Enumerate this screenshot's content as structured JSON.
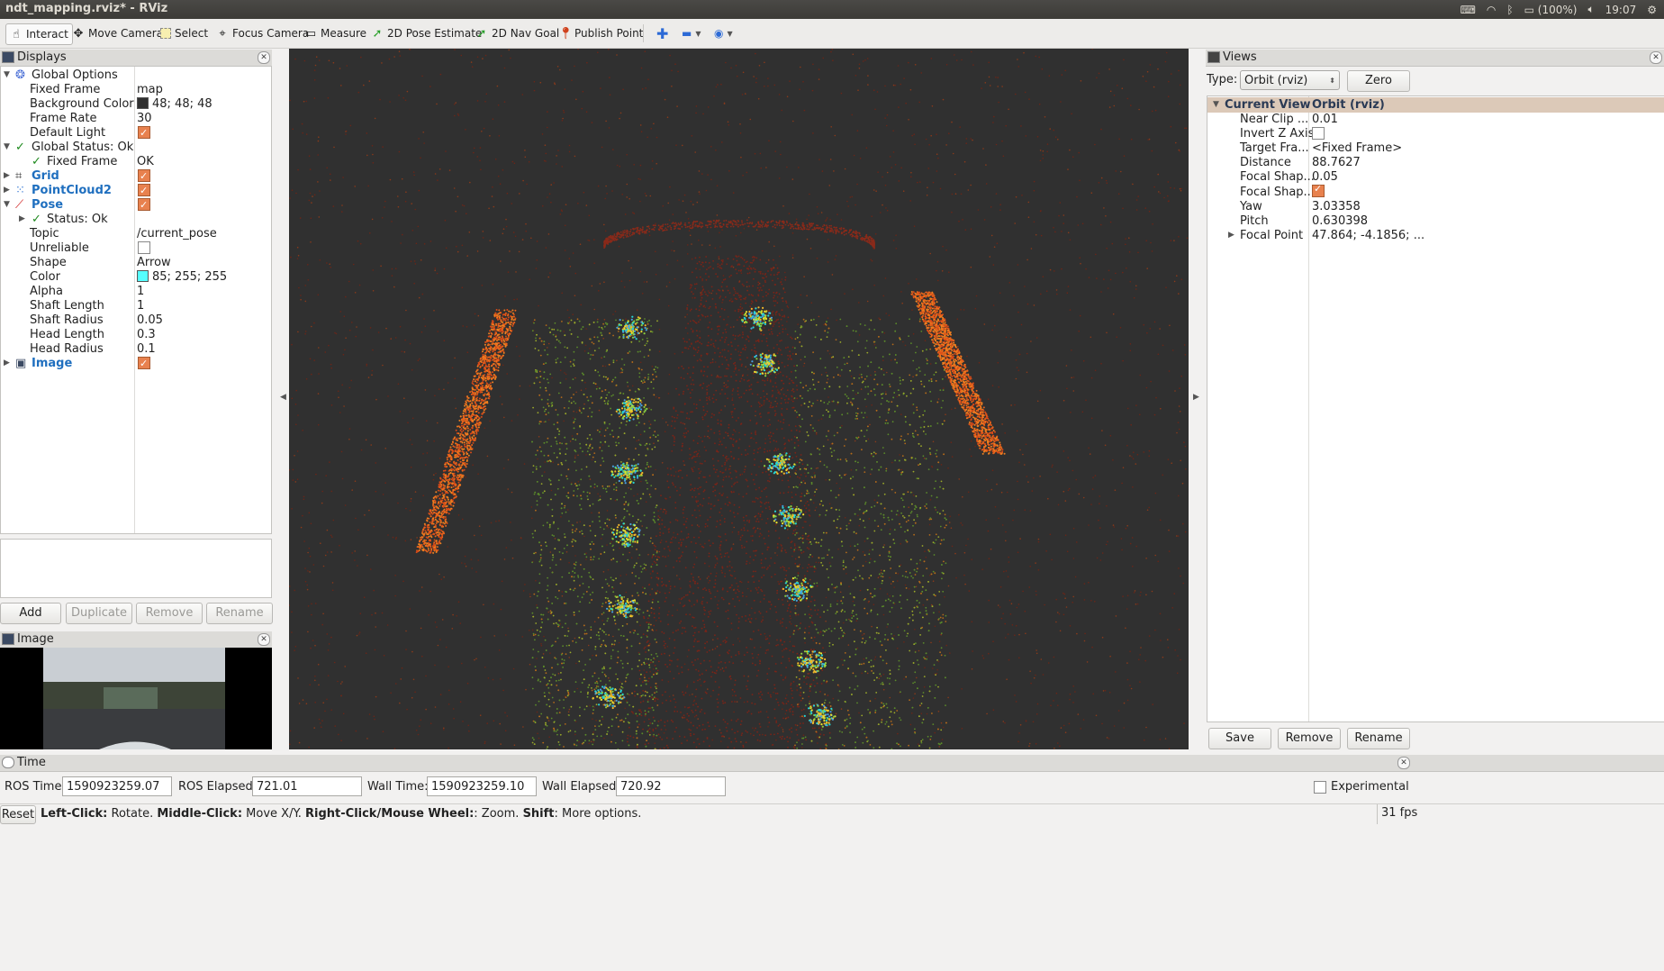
{
  "window": {
    "title": "ndt_mapping.rviz* - RViz"
  },
  "tray": {
    "battery": "(100%)",
    "clock": "19:07"
  },
  "toolbar": [
    {
      "label": "Interact",
      "icon": "hand-icon"
    },
    {
      "label": "Move Camera",
      "icon": "move-icon"
    },
    {
      "label": "Select",
      "icon": "select-icon"
    },
    {
      "label": "Focus Camera",
      "icon": "focus-icon"
    },
    {
      "label": "Measure",
      "icon": "ruler-icon"
    },
    {
      "label": "2D Pose Estimate",
      "icon": "green-arrow-icon"
    },
    {
      "label": "2D Nav Goal",
      "icon": "green-arrow-icon"
    },
    {
      "label": "Publish Point",
      "icon": "pin-icon"
    }
  ],
  "displays": {
    "title": "Displays",
    "global_options": "Global Options",
    "fixed_frame_label": "Fixed Frame",
    "fixed_frame_value": "map",
    "bg_color_label": "Background Color",
    "bg_color_value": "48; 48; 48",
    "bg_color_hex": "#303030",
    "frame_rate_label": "Frame Rate",
    "frame_rate_value": "30",
    "default_light_label": "Default Light",
    "global_status": "Global Status: Ok",
    "status_fixed_frame": "Fixed Frame",
    "status_fixed_frame_value": "OK",
    "grid": "Grid",
    "pointcloud": "PointCloud2",
    "pose": "Pose",
    "pose_status": "Status: Ok",
    "topic_label": "Topic",
    "topic_value": "/current_pose",
    "unreliable_label": "Unreliable",
    "shape_label": "Shape",
    "shape_value": "Arrow",
    "color_label": "Color",
    "color_value": "85; 255; 255",
    "color_hex": "#55ffff",
    "alpha_label": "Alpha",
    "alpha_value": "1",
    "shaft_length_label": "Shaft Length",
    "shaft_length_value": "1",
    "shaft_radius_label": "Shaft Radius",
    "shaft_radius_value": "0.05",
    "head_length_label": "Head Length",
    "head_length_value": "0.3",
    "head_radius_label": "Head Radius",
    "head_radius_value": "0.1",
    "image": "Image",
    "buttons": {
      "add": "Add",
      "duplicate": "Duplicate",
      "remove": "Remove",
      "rename": "Rename"
    }
  },
  "image_panel": {
    "title": "Image"
  },
  "views": {
    "title": "Views",
    "type_label": "Type:",
    "type_value": "Orbit (rviz)",
    "zero": "Zero",
    "current_view": "Current View",
    "current_view_value": "Orbit (rviz)",
    "props": [
      {
        "k": "Near Clip ...",
        "v": "0.01"
      },
      {
        "k": "Invert Z Axis",
        "v": "",
        "check": "off"
      },
      {
        "k": "Target Fra...",
        "v": "<Fixed Frame>"
      },
      {
        "k": "Distance",
        "v": "88.7627"
      },
      {
        "k": "Focal Shap...",
        "v": "0.05"
      },
      {
        "k": "Focal Shap...",
        "v": "",
        "check": "on"
      },
      {
        "k": "Yaw",
        "v": "3.03358"
      },
      {
        "k": "Pitch",
        "v": "0.630398"
      },
      {
        "k": "Focal Point",
        "v": "47.864; -4.1856; ..."
      }
    ],
    "buttons": {
      "save": "Save",
      "remove": "Remove",
      "rename": "Rename"
    }
  },
  "time": {
    "title": "Time",
    "ros_time_label": "ROS Time:",
    "ros_time": "1590923259.07",
    "ros_elapsed_label": "ROS Elapsed:",
    "ros_elapsed": "721.01",
    "wall_time_label": "Wall Time:",
    "wall_time": "1590923259.10",
    "wall_elapsed_label": "Wall Elapsed:",
    "wall_elapsed": "720.92",
    "experimental": "Experimental"
  },
  "status": {
    "reset": "Reset",
    "b1": "Left-Click:",
    "t1": " Rotate. ",
    "b2": "Middle-Click:",
    "t2": " Move X/Y. ",
    "b3": "Right-Click/Mouse Wheel:",
    "t3": ": Zoom. ",
    "b4": "Shift",
    "t4": ": More options.",
    "fps": "31 fps"
  }
}
